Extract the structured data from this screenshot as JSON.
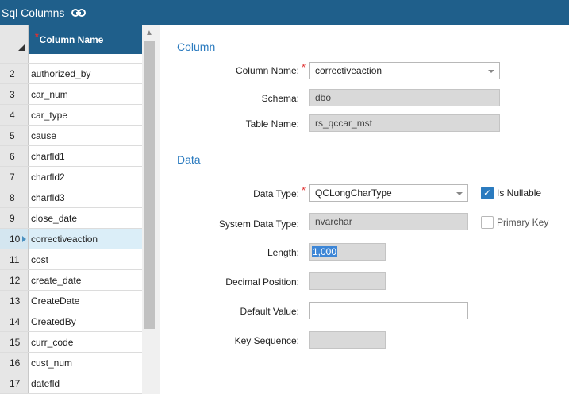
{
  "titlebar": {
    "title": "Sql Columns"
  },
  "grid": {
    "header": {
      "column_name": "Column Name"
    },
    "rows": [
      {
        "num": "2",
        "value": "authorized_by"
      },
      {
        "num": "3",
        "value": "car_num"
      },
      {
        "num": "4",
        "value": "car_type"
      },
      {
        "num": "5",
        "value": "cause"
      },
      {
        "num": "6",
        "value": "charfld1"
      },
      {
        "num": "7",
        "value": "charfld2"
      },
      {
        "num": "8",
        "value": "charfld3"
      },
      {
        "num": "9",
        "value": "close_date"
      },
      {
        "num": "10",
        "value": "correctiveaction"
      },
      {
        "num": "11",
        "value": "cost"
      },
      {
        "num": "12",
        "value": "create_date"
      },
      {
        "num": "13",
        "value": "CreateDate"
      },
      {
        "num": "14",
        "value": "CreatedBy"
      },
      {
        "num": "15",
        "value": "curr_code"
      },
      {
        "num": "16",
        "value": "cust_num"
      },
      {
        "num": "17",
        "value": "datefld"
      }
    ]
  },
  "form": {
    "column_section": "Column",
    "data_section": "Data",
    "column_name": {
      "label": "Column Name:",
      "value": "correctiveaction"
    },
    "schema": {
      "label": "Schema:",
      "value": "dbo"
    },
    "table_name": {
      "label": "Table Name:",
      "value": "rs_qccar_mst"
    },
    "data_type": {
      "label": "Data Type:",
      "value": "QCLongCharType"
    },
    "is_nullable": {
      "label": "Is Nullable",
      "checked": true
    },
    "system_data_type": {
      "label": "System Data Type:",
      "value": "nvarchar"
    },
    "primary_key": {
      "label": "Primary Key",
      "checked": false
    },
    "length": {
      "label": "Length:",
      "value": "1,000"
    },
    "decimal_position": {
      "label": "Decimal Position:",
      "value": ""
    },
    "default_value": {
      "label": "Default Value:",
      "value": ""
    },
    "key_sequence": {
      "label": "Key Sequence:",
      "value": ""
    }
  }
}
